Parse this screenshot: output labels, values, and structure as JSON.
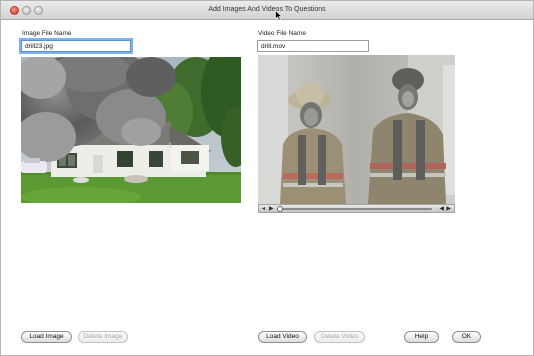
{
  "window": {
    "title": "Add Images And Videos To Questions"
  },
  "image_panel": {
    "label": "Image File Name",
    "file_name": "drill23.jpg"
  },
  "video_panel": {
    "label": "Video File Name",
    "file_name": "drill.mov"
  },
  "buttons": {
    "load_image": "Load Image",
    "delete_image": "Delete Image",
    "load_video": "Load Video",
    "delete_video": "Delete Video",
    "help": "Help",
    "ok": "OK"
  },
  "icons": {
    "window_close": "close-icon",
    "window_minimize": "minimize-icon",
    "window_zoom": "zoom-icon",
    "player_volume": "volume-icon",
    "player_play": "play-icon",
    "player_rewind": "rewind-icon",
    "player_forward": "fast-forward-icon"
  },
  "video_player": {
    "progress": 0.0
  }
}
